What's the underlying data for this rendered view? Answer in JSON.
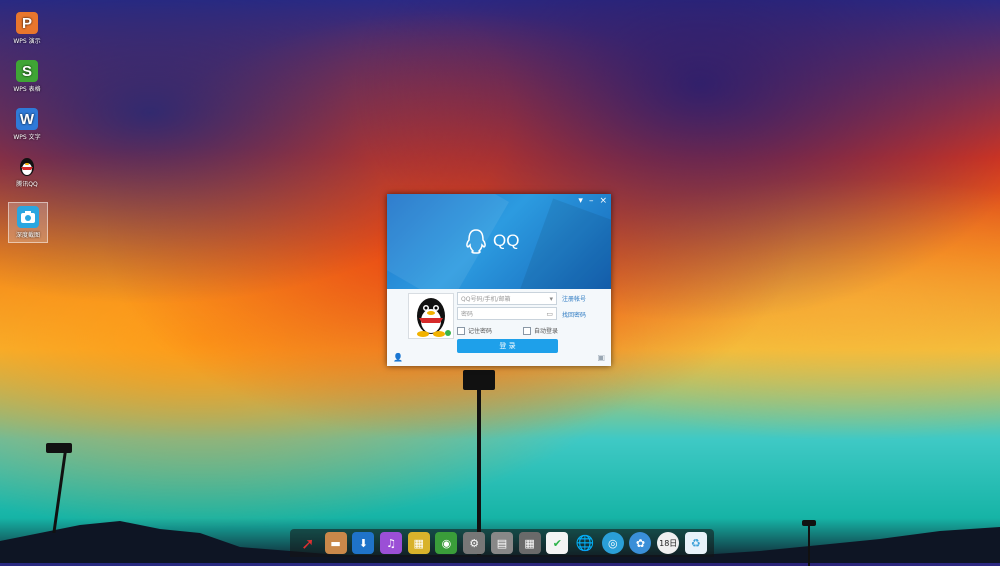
{
  "desktop": {
    "icons": [
      {
        "label": "WPS 演示",
        "glyph": "P",
        "color": "#e8762d"
      },
      {
        "label": "WPS 表格",
        "glyph": "S",
        "color": "#3fa535"
      },
      {
        "label": "WPS 文字",
        "glyph": "W",
        "color": "#2f7ad8"
      },
      {
        "label": "腾讯QQ",
        "glyph": "penguin",
        "color": ""
      },
      {
        "label": "深度截图",
        "glyph": "camera",
        "color": "#2aa6e0"
      }
    ]
  },
  "qq_window": {
    "brand": "QQ",
    "controls": {
      "menu": "▾",
      "minimize": "–",
      "close": "×"
    },
    "account_placeholder": "QQ号码/手机/邮箱",
    "password_placeholder": "密码",
    "register_link": "注册帐号",
    "recover_link": "找回密码",
    "remember_password": "记住密码",
    "auto_login": "自动登录",
    "login_button": "登 录"
  },
  "dock": {
    "items": [
      {
        "name": "launcher-icon",
        "glyph": "➚",
        "color": "#d62a2a"
      },
      {
        "name": "file-manager-icon",
        "glyph": "▬",
        "color": "#c9884a"
      },
      {
        "name": "store-icon",
        "glyph": "⬇",
        "color": "#1f73c9"
      },
      {
        "name": "music-icon",
        "glyph": "♫",
        "color": "#9b4fd6"
      },
      {
        "name": "video-icon",
        "glyph": "▦",
        "color": "#d8b22b"
      },
      {
        "name": "browser-icon",
        "glyph": "◉",
        "color": "#3a9d3a"
      },
      {
        "name": "settings-icon",
        "glyph": "⚙",
        "color": "#777777"
      },
      {
        "name": "terminal-icon",
        "glyph": "▤",
        "color": "#888888"
      },
      {
        "name": "calculator-icon",
        "glyph": "▦",
        "color": "#6a6a6a"
      },
      {
        "name": "tasks-icon",
        "glyph": "✔",
        "color": "#2eb34a"
      },
      {
        "name": "globe-icon",
        "glyph": "🌐",
        "color": "#1b6fc8"
      },
      {
        "name": "chat-icon",
        "glyph": "◎",
        "color": "#2a9fd8"
      },
      {
        "name": "network-icon",
        "glyph": "✿",
        "color": "#3a8fd8"
      },
      {
        "name": "calendar-icon",
        "glyph": "18日",
        "color": "#f0f0f0"
      },
      {
        "name": "trash-icon",
        "glyph": "♻",
        "color": "#3a9fd8"
      }
    ]
  }
}
